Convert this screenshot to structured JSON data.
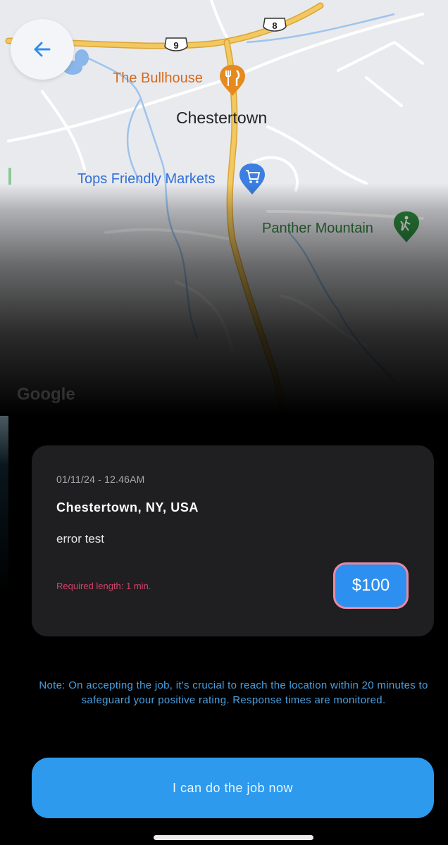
{
  "map": {
    "labels": {
      "restaurant": "The Bullhouse",
      "town": "Chestertown",
      "store": "Tops Friendly Markets",
      "mountain": "Panther Mountain",
      "watermark": "Google"
    },
    "road_shields": {
      "route_9": "9",
      "route_8": "8"
    },
    "icons": {
      "restaurant": "fork-knife-icon",
      "store": "shopping-cart-icon",
      "mountain": "hiker-icon"
    },
    "colors": {
      "restaurant_pin": "#e58a1e",
      "store_pin": "#3b7fe0",
      "mountain_pin": "#2e8b3e",
      "highway": "#f2c14e"
    }
  },
  "header": {
    "back_icon": "arrow-left-icon"
  },
  "job": {
    "datetime": "01/11/24 - 12.46AM",
    "location": "Chestertown, NY, USA",
    "description": "error test",
    "required_length": "Required length: 1 min.",
    "price": "$100"
  },
  "note": "Note: On accepting the job, it's crucial to reach the location within 20 minutes to safeguard your positive rating. Response times are monitored.",
  "actions": {
    "accept_label": "I can do the job now"
  },
  "colors": {
    "accent": "#2d9aee",
    "price_border": "#e98aa2",
    "required_text": "#d0436b",
    "note_text": "#4a9fe0",
    "card_bg": "#1f1f21"
  }
}
